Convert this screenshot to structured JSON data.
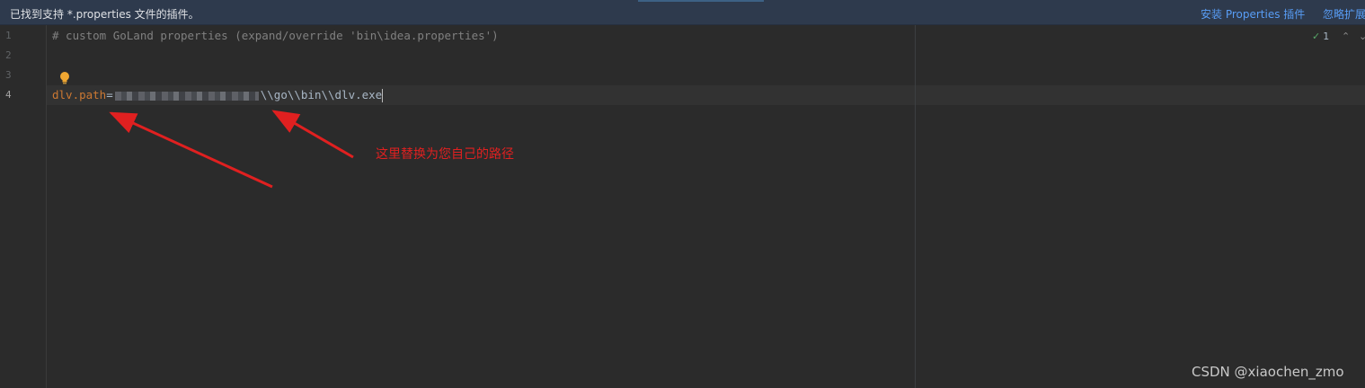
{
  "banner": {
    "message": "已找到支持 *.properties 文件的插件。",
    "install_link": "安装 Properties 插件",
    "ignore_link": "忽略扩展"
  },
  "gutter": {
    "line_numbers": [
      "1",
      "2",
      "3",
      "4"
    ]
  },
  "editor": {
    "line1_comment": "# custom GoLand properties (expand/override 'bin\\idea.properties')",
    "line4_key": "dlv.path",
    "line4_eq": "=",
    "line4_value_suffix": "\\\\go\\\\bin\\\\dlv.exe",
    "inspection_count": "1",
    "intention_icon": "lightbulb-icon"
  },
  "annotation": {
    "text": "这里替换为您自己的路径",
    "color": "#e02020"
  },
  "watermark": "CSDN @xiaochen_zmo",
  "colors": {
    "background": "#2b2b2b",
    "banner": "#2e3a4d",
    "link": "#589df6",
    "key": "#cc7832",
    "comment": "#808080"
  }
}
